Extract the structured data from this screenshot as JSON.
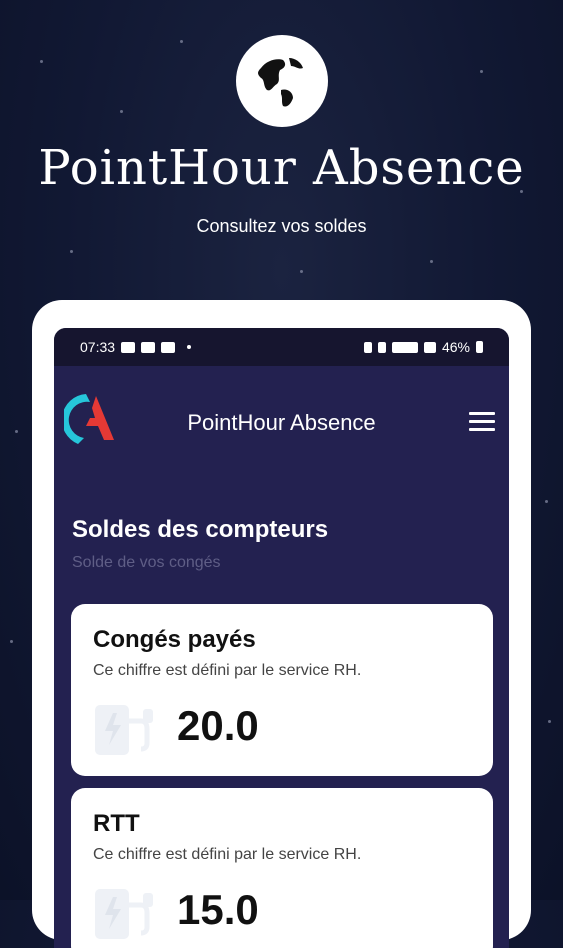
{
  "hero": {
    "title": "PointHour Absence",
    "subtitle": "Consultez vos soldes",
    "icon": "globe-icon"
  },
  "status_bar": {
    "time": "07:33",
    "battery": "46%"
  },
  "app_bar": {
    "title": "PointHour Absence",
    "logo": "app-logo-a",
    "menu_icon": "hamburger-menu-icon"
  },
  "section": {
    "title": "Soldes des compteurs",
    "subtitle": "Solde de vos congés"
  },
  "cards": [
    {
      "title": "Congés payés",
      "description": "Ce chiffre est défini par le service RH.",
      "value": "20.0",
      "icon": "charging-station-icon"
    },
    {
      "title": "RTT",
      "description": "Ce chiffre est défini par le service RH.",
      "value": "15.0",
      "icon": "charging-station-icon"
    }
  ],
  "colors": {
    "background": "#111833",
    "screen": "#232150",
    "logo_red": "#e53935",
    "logo_cyan": "#26c6da"
  }
}
